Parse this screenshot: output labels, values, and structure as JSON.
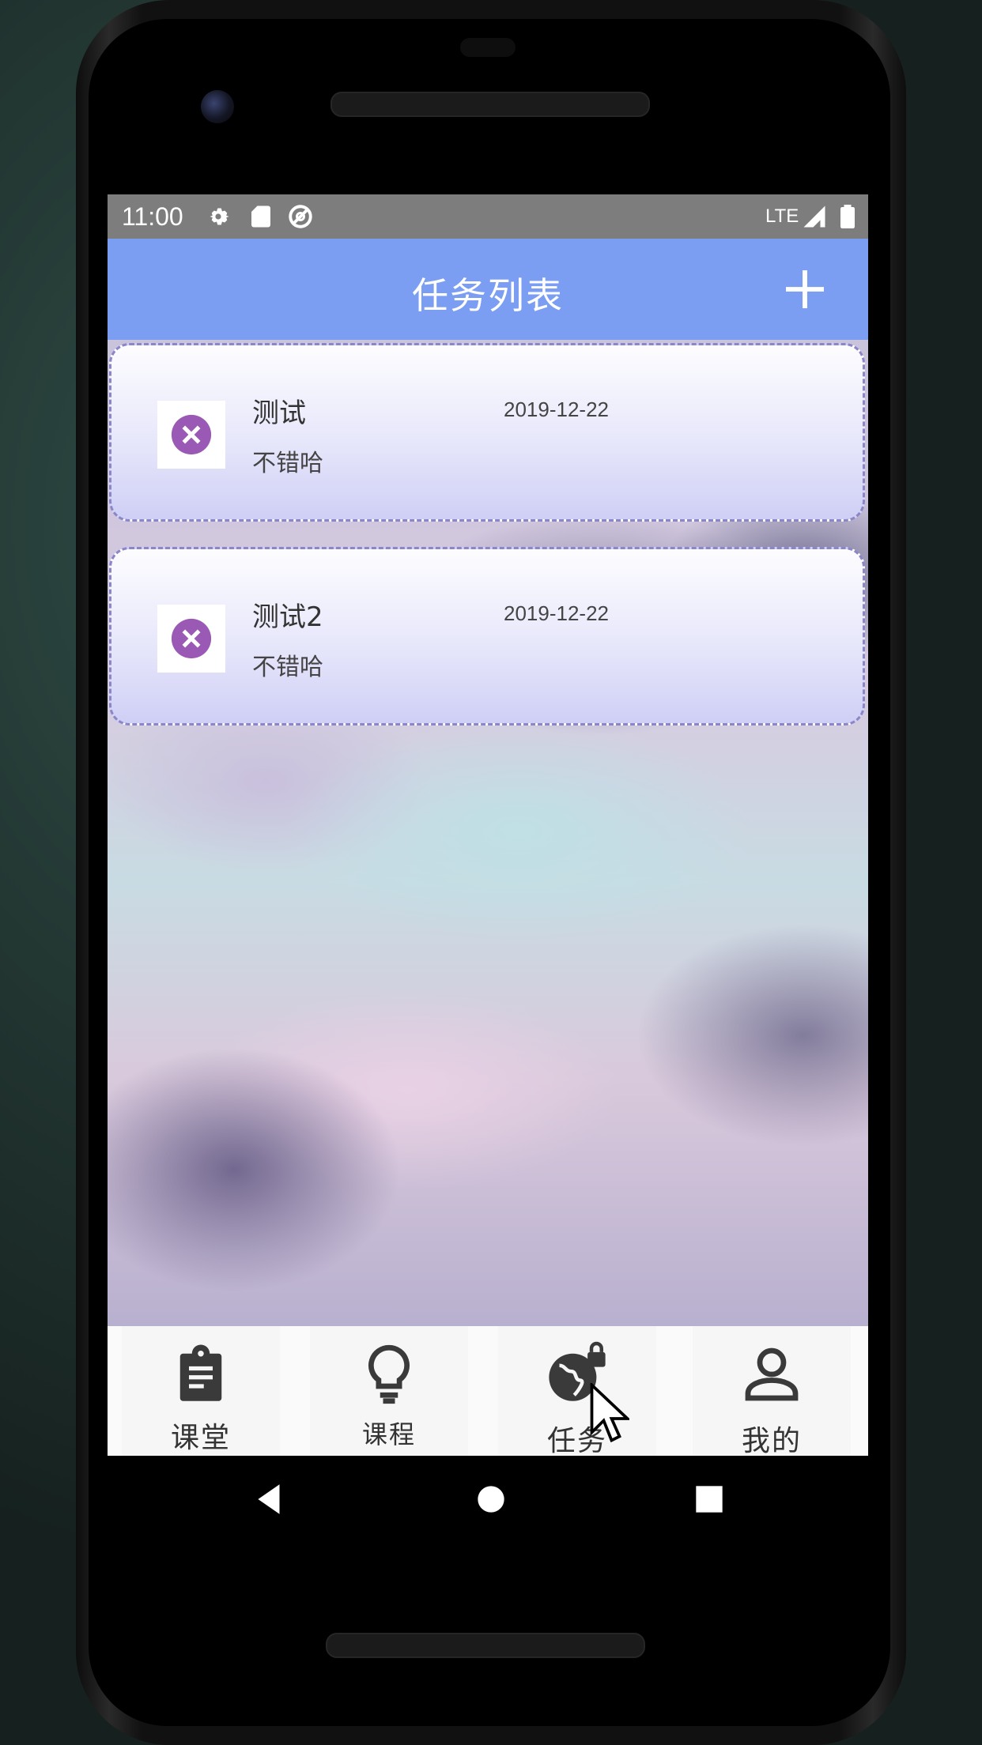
{
  "status_bar": {
    "time": "11:00",
    "icons": [
      "gear-icon",
      "sd-card-icon",
      "data-saver-icon",
      "lte-icon",
      "signal-icon",
      "battery-icon"
    ],
    "network_label": "LTE"
  },
  "app_bar": {
    "title": "任务列表",
    "add_icon": "plus-icon",
    "color": "#7b9ef2"
  },
  "tasks": [
    {
      "title": "测试",
      "date": "2019-12-22",
      "description": "不错哈",
      "delete_icon": "close-circle-icon"
    },
    {
      "title": "测试2",
      "date": "2019-12-22",
      "description": "不错哈",
      "delete_icon": "close-circle-icon"
    }
  ],
  "bottom_nav": {
    "items": [
      {
        "label": "课堂",
        "icon": "clipboard-icon"
      },
      {
        "label": "课程",
        "icon": "lightbulb-icon"
      },
      {
        "label": "任务",
        "icon": "globe-lock-icon"
      },
      {
        "label": "我的",
        "icon": "person-icon"
      }
    ]
  },
  "system_nav": {
    "icons": [
      "back-icon",
      "home-icon",
      "recents-icon"
    ]
  },
  "colors": {
    "accent": "#9b59b6",
    "card_border": "#8a86c8"
  }
}
